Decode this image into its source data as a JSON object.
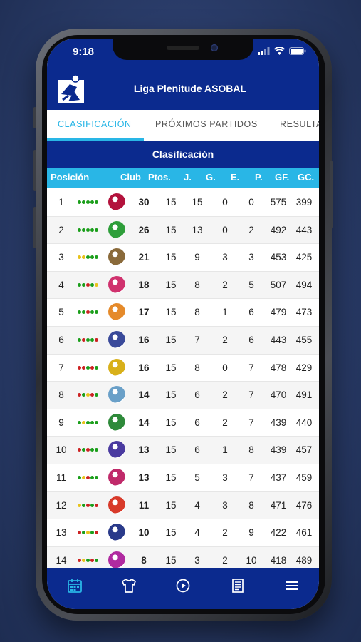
{
  "status_bar": {
    "time": "9:18"
  },
  "app": {
    "title": "Liga Plenitude ASOBAL"
  },
  "tabs": [
    {
      "label": "CLASIFICACIÓN"
    },
    {
      "label": "PRÓXIMOS PARTIDOS"
    },
    {
      "label": "RESULTA"
    }
  ],
  "section": {
    "title": "Clasificación"
  },
  "table": {
    "headers": {
      "pos": "Posición",
      "club": "Club",
      "pts": "Ptos.",
      "j": "J.",
      "g": "G.",
      "e": "E.",
      "p": "P.",
      "gf": "GF.",
      "gc": "GC."
    },
    "rows": [
      {
        "pos": "1",
        "form": [
          "#1a9e1a",
          "#1a9e1a",
          "#1a9e1a",
          "#1a9e1a",
          "#1a9e1a"
        ],
        "crest": "#b3123c",
        "pts": "30",
        "j": "15",
        "g": "15",
        "e": "0",
        "p": "0",
        "gf": "575",
        "gc": "399"
      },
      {
        "pos": "2",
        "form": [
          "#1a9e1a",
          "#1a9e1a",
          "#1a9e1a",
          "#1a9e1a",
          "#1a9e1a"
        ],
        "crest": "#2e9e3a",
        "pts": "26",
        "j": "15",
        "g": "13",
        "e": "0",
        "p": "2",
        "gf": "492",
        "gc": "443"
      },
      {
        "pos": "3",
        "form": [
          "#e8c21a",
          "#e8c21a",
          "#1a9e1a",
          "#1a9e1a",
          "#1a9e1a"
        ],
        "crest": "#8a6a3a",
        "pts": "21",
        "j": "15",
        "g": "9",
        "e": "3",
        "p": "3",
        "gf": "453",
        "gc": "425"
      },
      {
        "pos": "4",
        "form": [
          "#1a9e1a",
          "#1a9e1a",
          "#cc2222",
          "#1a9e1a",
          "#e8c21a"
        ],
        "crest": "#d0326e",
        "pts": "18",
        "j": "15",
        "g": "8",
        "e": "2",
        "p": "5",
        "gf": "507",
        "gc": "494"
      },
      {
        "pos": "5",
        "form": [
          "#1a9e1a",
          "#1a9e1a",
          "#cc2222",
          "#1a9e1a",
          "#1a9e1a"
        ],
        "crest": "#e58a2a",
        "pts": "17",
        "j": "15",
        "g": "8",
        "e": "1",
        "p": "6",
        "gf": "479",
        "gc": "473"
      },
      {
        "pos": "6",
        "form": [
          "#1a9e1a",
          "#cc2222",
          "#1a9e1a",
          "#1a9e1a",
          "#cc2222"
        ],
        "crest": "#3a4a9a",
        "pts": "16",
        "j": "15",
        "g": "7",
        "e": "2",
        "p": "6",
        "gf": "443",
        "gc": "455"
      },
      {
        "pos": "7",
        "form": [
          "#cc2222",
          "#cc2222",
          "#1a9e1a",
          "#cc2222",
          "#1a9e1a"
        ],
        "crest": "#d8b01a",
        "pts": "16",
        "j": "15",
        "g": "8",
        "e": "0",
        "p": "7",
        "gf": "478",
        "gc": "429"
      },
      {
        "pos": "8",
        "form": [
          "#cc2222",
          "#1a9e1a",
          "#e8c21a",
          "#cc2222",
          "#1a9e1a"
        ],
        "crest": "#6aa0c8",
        "pts": "14",
        "j": "15",
        "g": "6",
        "e": "2",
        "p": "7",
        "gf": "470",
        "gc": "491"
      },
      {
        "pos": "9",
        "form": [
          "#1a9e1a",
          "#e8c21a",
          "#1a9e1a",
          "#1a9e1a",
          "#1a9e1a"
        ],
        "crest": "#2e8a3a",
        "pts": "14",
        "j": "15",
        "g": "6",
        "e": "2",
        "p": "7",
        "gf": "439",
        "gc": "440"
      },
      {
        "pos": "10",
        "form": [
          "#cc2222",
          "#1a9e1a",
          "#cc2222",
          "#1a9e1a",
          "#1a9e1a"
        ],
        "crest": "#4a3aa0",
        "pts": "13",
        "j": "15",
        "g": "6",
        "e": "1",
        "p": "8",
        "gf": "439",
        "gc": "457"
      },
      {
        "pos": "11",
        "form": [
          "#1a9e1a",
          "#e8c21a",
          "#cc2222",
          "#1a9e1a",
          "#1a9e1a"
        ],
        "crest": "#c02a6a",
        "pts": "13",
        "j": "15",
        "g": "5",
        "e": "3",
        "p": "7",
        "gf": "437",
        "gc": "459"
      },
      {
        "pos": "12",
        "form": [
          "#e8c21a",
          "#1a9e1a",
          "#cc2222",
          "#1a9e1a",
          "#cc2222"
        ],
        "crest": "#d83a2a",
        "pts": "11",
        "j": "15",
        "g": "4",
        "e": "3",
        "p": "8",
        "gf": "471",
        "gc": "476"
      },
      {
        "pos": "13",
        "form": [
          "#cc2222",
          "#1a9e1a",
          "#e8c21a",
          "#1a9e1a",
          "#cc2222"
        ],
        "crest": "#2a3a8a",
        "pts": "10",
        "j": "15",
        "g": "4",
        "e": "2",
        "p": "9",
        "gf": "422",
        "gc": "461"
      },
      {
        "pos": "14",
        "form": [
          "#cc2222",
          "#e8c21a",
          "#1a9e1a",
          "#cc2222",
          "#1a9e1a"
        ],
        "crest": "#b02aa0",
        "pts": "8",
        "j": "15",
        "g": "3",
        "e": "2",
        "p": "10",
        "gf": "418",
        "gc": "489"
      }
    ]
  },
  "bottom_nav": [
    {
      "icon": "calendar-icon",
      "active": true
    },
    {
      "icon": "shirt-icon",
      "active": false
    },
    {
      "icon": "play-icon",
      "active": false
    },
    {
      "icon": "news-icon",
      "active": false
    },
    {
      "icon": "menu-icon",
      "active": false
    }
  ],
  "colors": {
    "brand": "#0b2a8e",
    "accent": "#29b6e6",
    "win": "#1a9e1a",
    "draw": "#e8c21a",
    "loss": "#cc2222"
  }
}
